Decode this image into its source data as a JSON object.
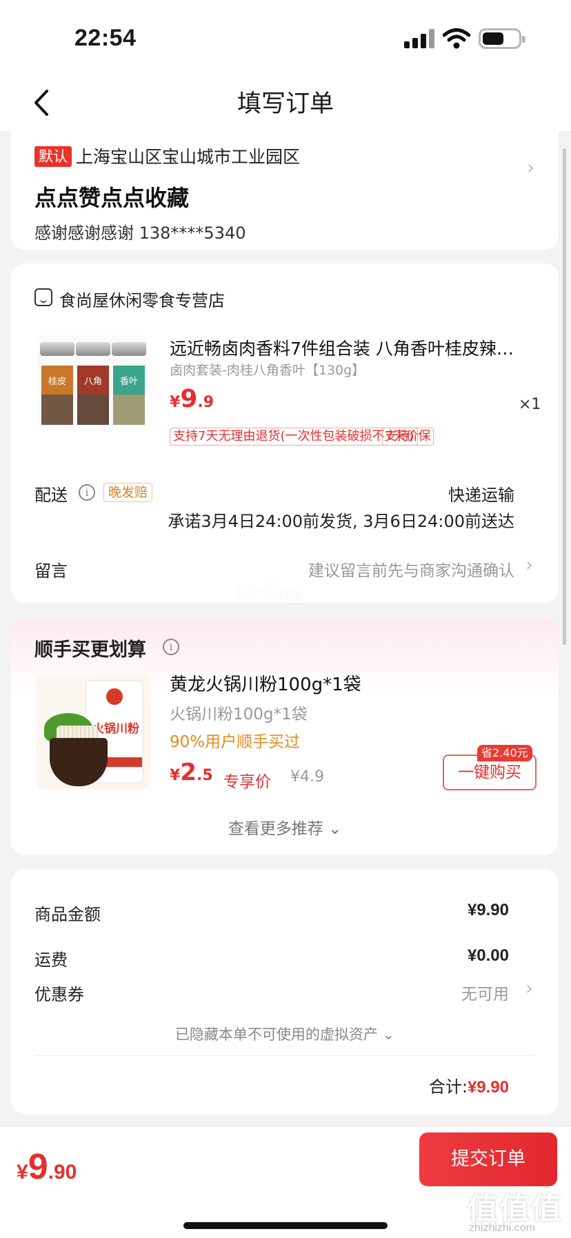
{
  "status_bar": {
    "time": "22:54"
  },
  "nav": {
    "title": "填写订单"
  },
  "address": {
    "default_badge": "默认",
    "region": "上海宝山区宝山城市工业园区",
    "name": "点点赞点点收藏",
    "contact": "感谢感谢感谢  138****5340"
  },
  "order": {
    "shop_name": "食尚屋休闲零食专营店",
    "product": {
      "title": "远近畅卤肉香料7件组合装 八角香叶桂皮辣…",
      "spec": "卤肉套装-肉桂八角香叶【130g】",
      "price_currency": "¥",
      "price_int": "9",
      "price_dec": ".9",
      "quantity": "×1",
      "jar_labels": [
        "桂皮",
        "八角",
        "香叶"
      ]
    },
    "tags": [
      "支持7天无理由退货(一次性包装破损不支持)",
      "7天价保"
    ],
    "delivery": {
      "label": "配送",
      "late_badge": "晚发赔",
      "method": "快递运输",
      "promise": "承诺3月4日24:00前发货, 3月6日24:00前送达"
    },
    "message": {
      "label": "留言",
      "hint": "建议留言前先与商家沟通确认"
    }
  },
  "watermark": "ktcking",
  "recommend": {
    "title": "顺手买更划算",
    "item": {
      "name": "黄龙火锅川粉100g*1袋",
      "spec": "火锅川粉100g*1袋",
      "social": "90%用户顺手买过",
      "price_currency": "¥",
      "price_int": "2",
      "price_dec": ".5",
      "price_label": "专享价",
      "original_price": "¥4.9",
      "save_badge": "省2.40元",
      "buy_button": "一键购买",
      "image_text": "火锅川粉"
    },
    "more": "查看更多推荐"
  },
  "summary": {
    "goods_label": "商品金额",
    "goods_value": "¥9.90",
    "shipping_label": "运费",
    "shipping_value": "¥0.00",
    "coupon_label": "优惠券",
    "coupon_value": "无可用",
    "hidden_assets": "已隐藏本单不可使用的虚拟资产",
    "total_label": "合计:",
    "total_value": "¥9.90"
  },
  "bottom": {
    "price_currency": "¥",
    "price_int": "9",
    "price_dec": ".90",
    "submit": "提交订单",
    "site_watermark": "值值值",
    "site_domain": "zhizhizhi.com"
  },
  "colors": {
    "accent": "#e52f2f",
    "orange": "#e08c1c",
    "background": "#f3f3f3"
  }
}
